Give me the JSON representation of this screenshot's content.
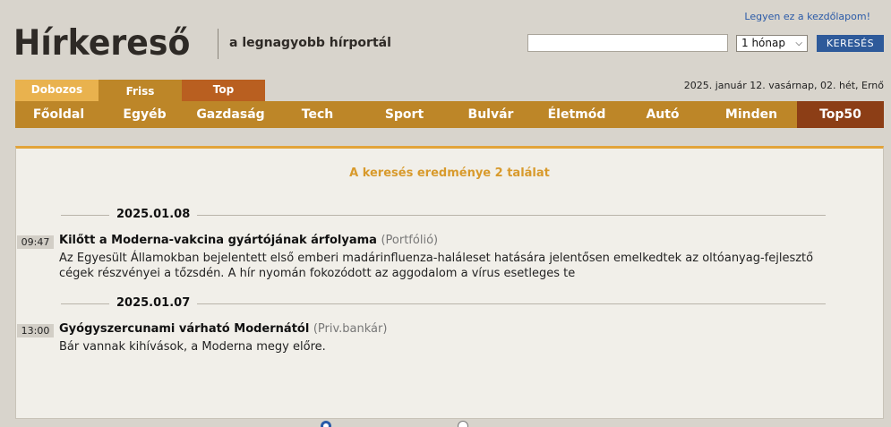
{
  "header": {
    "logo_text": "Hírkereső",
    "tagline": "a legnagyobb hírportál",
    "homepage_link": "Legyen ez a kezdőlapom!",
    "search": {
      "value": "",
      "placeholder": ""
    },
    "period_select": {
      "selected": "1 hónap"
    },
    "search_button": "KERESÉS"
  },
  "subtabs": [
    {
      "label": "Dobozos"
    },
    {
      "label": "Friss"
    },
    {
      "label": "Top"
    }
  ],
  "date_line": "2025. január 12. vasárnap, 02. hét, Ernő",
  "nav": [
    {
      "label": "Főoldal"
    },
    {
      "label": "Egyéb"
    },
    {
      "label": "Gazdaság"
    },
    {
      "label": "Tech"
    },
    {
      "label": "Sport"
    },
    {
      "label": "Bulvár"
    },
    {
      "label": "Életmód"
    },
    {
      "label": "Autó"
    },
    {
      "label": "Minden"
    },
    {
      "label": "Top50"
    }
  ],
  "results": {
    "summary": "A keresés eredménye 2 találat",
    "groups": [
      {
        "date": "2025.01.08",
        "items": [
          {
            "time": "09:47",
            "title": "Kilőtt a Moderna-vakcina gyártójának árfolyama",
            "source": "(Portfólió)",
            "lead": "Az Egyesült Államokban bejelentett első emberi madárinfluenza-haláleset hatására jelentősen emelkedtek az oltóanyag-fejlesztő cégek részvényei a tőzsdén. A hír nyomán fokozódott az aggodalom a vírus esetleges te"
          }
        ]
      },
      {
        "date": "2025.01.07",
        "items": [
          {
            "time": "13:00",
            "title": "Gyógyszercunami várható Modernától",
            "source": "(Priv.bankár)",
            "lead": "Bár vannak kihívások, a Moderna megy előre."
          }
        ]
      }
    ]
  },
  "colors": {
    "background": "#d8d4cc",
    "nav_orange": "#bd8628",
    "top50_brown": "#8c3e16",
    "accent_gold": "#d89a2c",
    "button_blue": "#2e5a9a"
  }
}
